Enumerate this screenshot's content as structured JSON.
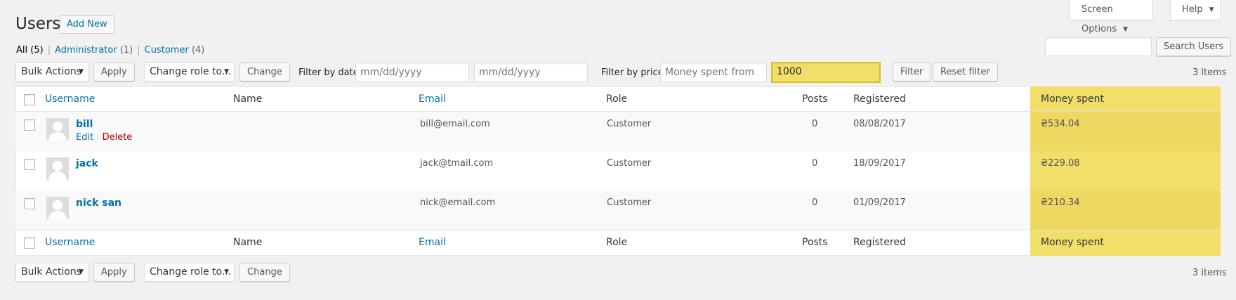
{
  "screen_meta": {
    "screen_options": "Screen Options",
    "help": "Help"
  },
  "page": {
    "title": "Users",
    "add_new": "Add New"
  },
  "views": {
    "all": "All",
    "all_count": "(5)",
    "administrator": "Administrator",
    "administrator_count": "(1)",
    "customer": "Customer",
    "customer_count": "(4)"
  },
  "search": {
    "button": "Search Users",
    "value": ""
  },
  "top_nav": {
    "bulk_actions": "Bulk Actions",
    "apply": "Apply",
    "change_role": "Change role to...",
    "change": "Change",
    "filter_by_date_label": "Filter by date",
    "date_from_placeholder": "mm/dd/yyyy",
    "date_to_placeholder": "mm/dd/yyyy",
    "filter_by_price_label": "Filter by price",
    "money_from_placeholder": "Money spent from",
    "money_to_value": "1000",
    "filter": "Filter",
    "reset_filter": "Reset filter",
    "items_count": "3 items"
  },
  "table": {
    "columns": {
      "username": "Username",
      "name": "Name",
      "email": "Email",
      "role": "Role",
      "posts": "Posts",
      "registered": "Registered",
      "money_spent": "Money spent"
    },
    "row_actions": {
      "edit": "Edit",
      "delete": "Delete"
    },
    "rows": [
      {
        "username": "bill",
        "name": "",
        "email": "bill@email.com",
        "role": "Customer",
        "posts": "0",
        "registered": "08/08/2017",
        "money_spent": "₴534.04"
      },
      {
        "username": "jack",
        "name": "",
        "email": "jack@tmail.com",
        "role": "Customer",
        "posts": "0",
        "registered": "18/09/2017",
        "money_spent": "₴229.08"
      },
      {
        "username": "nick san",
        "name": "",
        "email": "nick@email.com",
        "role": "Customer",
        "posts": "0",
        "registered": "01/09/2017",
        "money_spent": "₴210.34"
      }
    ]
  },
  "bottom_nav": {
    "bulk_actions": "Bulk Actions",
    "apply": "Apply",
    "change_role": "Change role to...",
    "change": "Change",
    "items_count": "3 items"
  },
  "colors": {
    "highlight": "#f2df6a",
    "link": "#0073aa",
    "delete": "#aa0000"
  }
}
